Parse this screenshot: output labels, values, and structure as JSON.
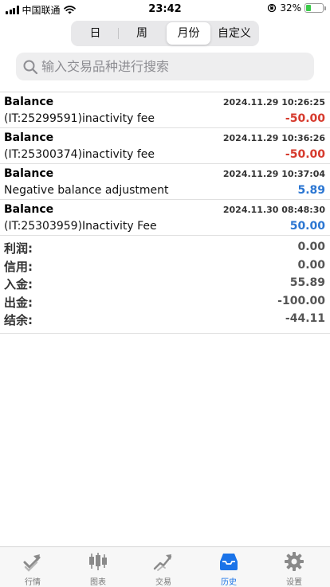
{
  "status_bar": {
    "carrier": "中国联通",
    "time": "23:42",
    "battery": "32%",
    "battery_level": 0.32
  },
  "period_tabs": [
    {
      "label": "日",
      "active": false
    },
    {
      "label": "周",
      "active": false
    },
    {
      "label": "月份",
      "active": true
    },
    {
      "label": "自定义",
      "active": false
    }
  ],
  "search": {
    "placeholder": "输入交易品种进行搜索"
  },
  "entries": [
    {
      "type": "Balance",
      "datetime": "2024.11.29 10:26:25",
      "comment": "(IT:25299591)inactivity fee",
      "amount": "-50.00",
      "sign": "neg"
    },
    {
      "type": "Balance",
      "datetime": "2024.11.29 10:36:26",
      "comment": "(IT:25300374)inactivity fee",
      "amount": "-50.00",
      "sign": "neg"
    },
    {
      "type": "Balance",
      "datetime": "2024.11.29 10:37:04",
      "comment": "Negative balance adjustment",
      "amount": "5.89",
      "sign": "pos"
    },
    {
      "type": "Balance",
      "datetime": "2024.11.30 08:48:30",
      "comment": "(IT:25303959)Inactivity Fee",
      "amount": "50.00",
      "sign": "pos"
    }
  ],
  "summary": [
    {
      "label": "利润:",
      "value": "0.00"
    },
    {
      "label": "信用:",
      "value": "0.00"
    },
    {
      "label": "入金:",
      "value": "55.89"
    },
    {
      "label": "出金:",
      "value": "-100.00"
    },
    {
      "label": "结余:",
      "value": "-44.11"
    }
  ],
  "colors": {
    "negative": "#d63a2d",
    "positive": "#2b76d2",
    "active_tab": "#1a73e8"
  },
  "bottom_nav": [
    {
      "label": "行情",
      "icon": "quotes-icon",
      "active": false
    },
    {
      "label": "图表",
      "icon": "candlestick-chart-icon",
      "active": false
    },
    {
      "label": "交易",
      "icon": "trade-icon",
      "active": false
    },
    {
      "label": "历史",
      "icon": "history-inbox-icon",
      "active": true
    },
    {
      "label": "设置",
      "icon": "settings-gear-icon",
      "active": false
    }
  ]
}
